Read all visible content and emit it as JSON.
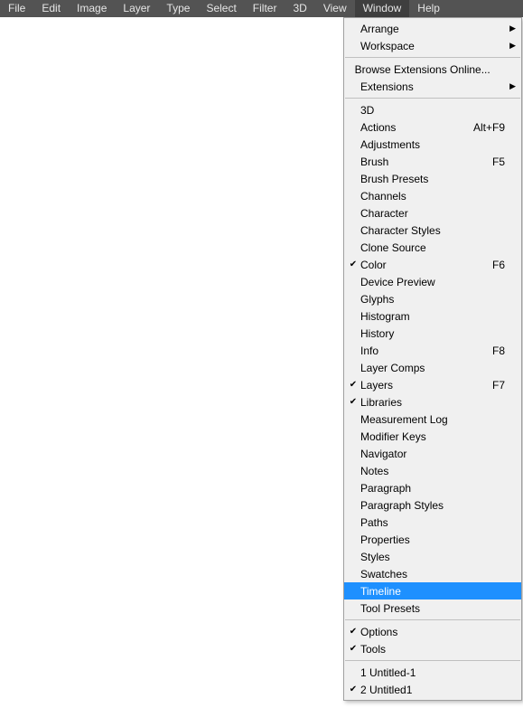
{
  "menubar": {
    "items": [
      {
        "label": "File"
      },
      {
        "label": "Edit"
      },
      {
        "label": "Image"
      },
      {
        "label": "Layer"
      },
      {
        "label": "Type"
      },
      {
        "label": "Select"
      },
      {
        "label": "Filter"
      },
      {
        "label": "3D"
      },
      {
        "label": "View"
      },
      {
        "label": "Window",
        "active": true
      },
      {
        "label": "Help"
      }
    ]
  },
  "dropdown": {
    "groups": [
      [
        {
          "label": "Arrange",
          "submenu": true
        },
        {
          "label": "Workspace",
          "submenu": true
        }
      ],
      [
        {
          "label": "Browse Extensions Online..."
        },
        {
          "label": "Extensions",
          "submenu": true
        }
      ],
      [
        {
          "label": "3D"
        },
        {
          "label": "Actions",
          "accel": "Alt+F9"
        },
        {
          "label": "Adjustments"
        },
        {
          "label": "Brush",
          "accel": "F5"
        },
        {
          "label": "Brush Presets"
        },
        {
          "label": "Channels"
        },
        {
          "label": "Character"
        },
        {
          "label": "Character Styles"
        },
        {
          "label": "Clone Source"
        },
        {
          "label": "Color",
          "accel": "F6",
          "checked": true
        },
        {
          "label": "Device Preview"
        },
        {
          "label": "Glyphs"
        },
        {
          "label": "Histogram"
        },
        {
          "label": "History"
        },
        {
          "label": "Info",
          "accel": "F8"
        },
        {
          "label": "Layer Comps"
        },
        {
          "label": "Layers",
          "accel": "F7",
          "checked": true
        },
        {
          "label": "Libraries",
          "checked": true
        },
        {
          "label": "Measurement Log"
        },
        {
          "label": "Modifier Keys"
        },
        {
          "label": "Navigator"
        },
        {
          "label": "Notes"
        },
        {
          "label": "Paragraph"
        },
        {
          "label": "Paragraph Styles"
        },
        {
          "label": "Paths"
        },
        {
          "label": "Properties"
        },
        {
          "label": "Styles"
        },
        {
          "label": "Swatches"
        },
        {
          "label": "Timeline",
          "highlight": true
        },
        {
          "label": "Tool Presets"
        }
      ],
      [
        {
          "label": "Options",
          "checked": true
        },
        {
          "label": "Tools",
          "checked": true
        }
      ],
      [
        {
          "label": "1 Untitled-1"
        },
        {
          "label": "2 Untitled1",
          "checked": true
        }
      ]
    ]
  }
}
